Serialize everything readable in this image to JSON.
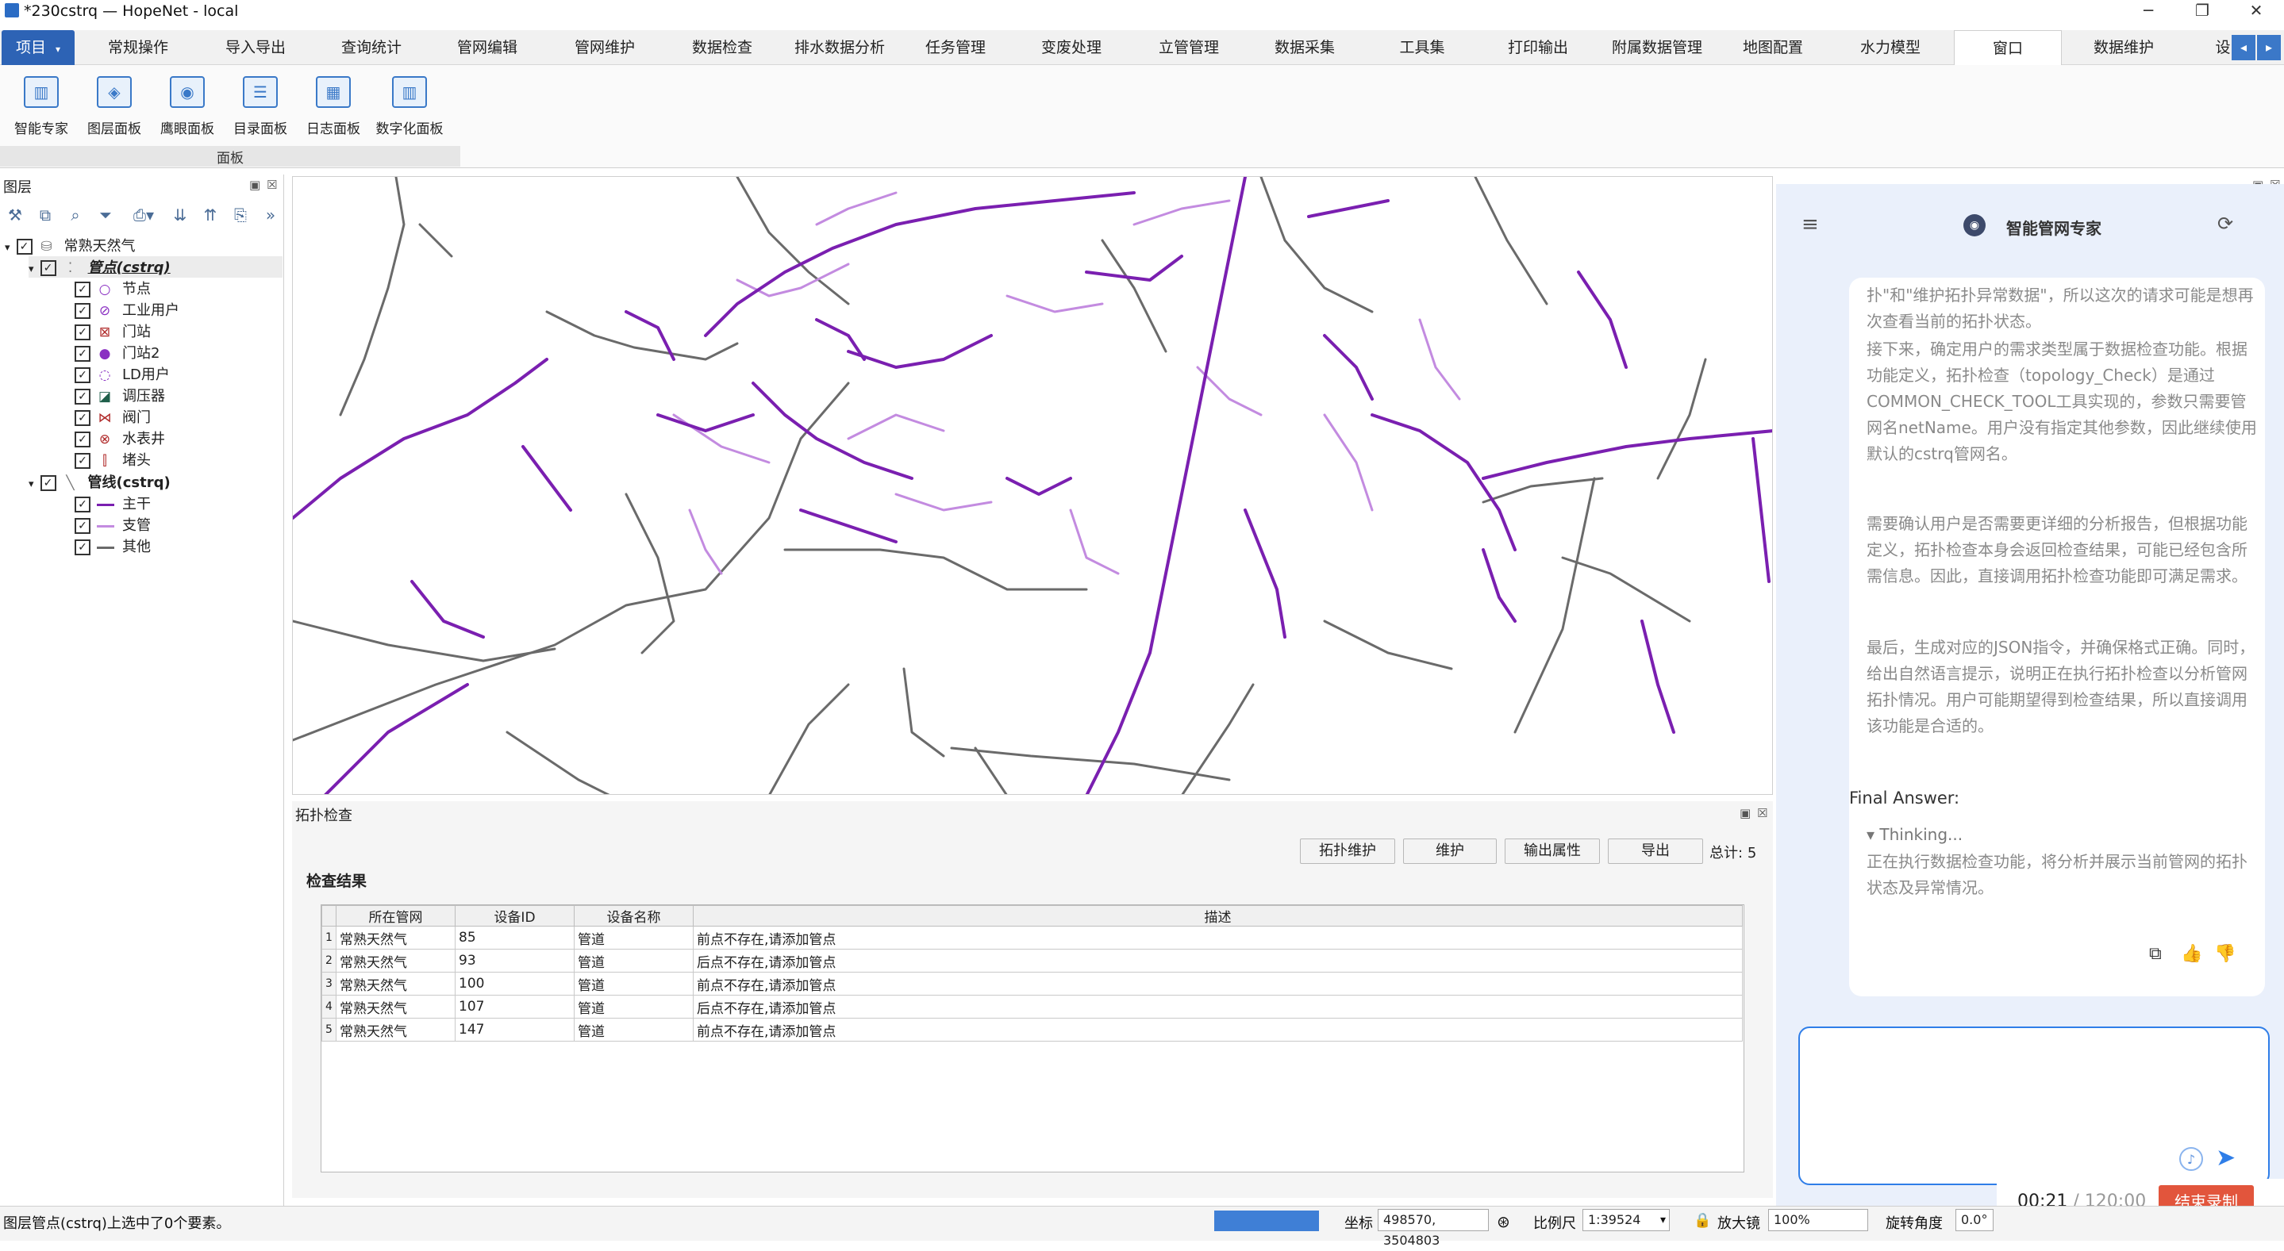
{
  "window": {
    "title": "*230cstrq — HopeNet - local",
    "minimize": "─",
    "restore": "❐",
    "close": "✕"
  },
  "tabs": {
    "project": "项目",
    "items": [
      "常规操作",
      "导入导出",
      "查询统计",
      "管网编辑",
      "管网维护",
      "数据检查",
      "排水数据分析",
      "任务管理",
      "变废处理",
      "立管管理",
      "数据采集",
      "工具集",
      "打印输出",
      "附属数据管理",
      "地图配置",
      "水力模型",
      "窗口",
      "数据维护",
      "设"
    ],
    "active": "窗口"
  },
  "ribbon": {
    "buttons": [
      "智能专家",
      "图层面板",
      "鹰眼面板",
      "目录面板",
      "日志面板",
      "数字化面板"
    ],
    "group_label": "面板"
  },
  "layer_panel": {
    "title": "图层",
    "tree": {
      "root": "常熟天然气",
      "point_layer": "管点(cstrq)",
      "point_items": [
        "节点",
        "工业用户",
        "门站",
        "门站2",
        "LD用户",
        "调压器",
        "阀门",
        "水表井",
        "堵头"
      ],
      "line_layer": "管线(cstrq)",
      "line_items": [
        "主干",
        "支管",
        "其他"
      ]
    }
  },
  "topology": {
    "title": "拓扑检查",
    "buttons": [
      "拓扑维护",
      "维护",
      "输出属性",
      "导出"
    ],
    "total_label": "总计:",
    "total": "5",
    "result_title": "检查结果",
    "columns": [
      "所在管网",
      "设备ID",
      "设备名称",
      "描述"
    ],
    "rows": [
      {
        "n": "1",
        "network": "常熟天然气",
        "id": "85",
        "name": "管道",
        "desc": "前点不存在,请添加管点"
      },
      {
        "n": "2",
        "network": "常熟天然气",
        "id": "93",
        "name": "管道",
        "desc": "后点不存在,请添加管点"
      },
      {
        "n": "3",
        "network": "常熟天然气",
        "id": "100",
        "name": "管道",
        "desc": "前点不存在,请添加管点"
      },
      {
        "n": "4",
        "network": "常熟天然气",
        "id": "107",
        "name": "管道",
        "desc": "后点不存在,请添加管点"
      },
      {
        "n": "5",
        "network": "常熟天然气",
        "id": "147",
        "name": "管道",
        "desc": "前点不存在,请添加管点"
      }
    ]
  },
  "chat": {
    "title": "智能管网专家",
    "para1": "扑\"和\"维护拓扑异常数据\"，所以这次的请求可能是想再次查看当前的拓扑状态。",
    "para2": "接下来，确定用户的需求类型属于数据检查功能。根据功能定义，拓扑检查（topology_Check）是通过COMMON_CHECK_TOOL工具实现的，参数只需要管网名netName。用户没有指定其他参数，因此继续使用默认的cstrq管网名。",
    "para3": "需要确认用户是否需要更详细的分析报告，但根据功能定义，拓扑检查本身会返回检查结果，可能已经包含所需信息。因此，直接调用拓扑检查功能即可满足需求。",
    "para4": "最后，生成对应的JSON指令，并确保格式正确。同时，给出自然语言提示，说明正在执行拓扑检查以分析管网拓扑情况。用户可能期望得到检查结果，所以直接调用该功能是合适的。",
    "final_answer": "Final Answer:",
    "thinking": "Thinking...",
    "answer": "正在执行数据检查功能，将分析并展示当前管网的拓扑状态及异常情况。",
    "input_value": ""
  },
  "recording": {
    "time": "00:21",
    "total": "/ 120:00",
    "stop_button": "结束录制"
  },
  "status": {
    "message": "图层管点(cstrq)上选中了0个要素。",
    "coord_label": "坐标",
    "coord_value": "498570, 3504803",
    "scale_label": "比例尺",
    "scale_value": "1:39524",
    "magnifier_label": "放大镜",
    "magnifier_value": "100%",
    "rotation_label": "旋转角度",
    "rotation_value": "0.0°"
  },
  "colors": {
    "primary_blue": "#2d63b5",
    "main_pipe": "#7a1fb0",
    "branch_pipe": "#c38be0",
    "other_pipe": "#6a6a6a",
    "record_red": "#e2553c"
  }
}
